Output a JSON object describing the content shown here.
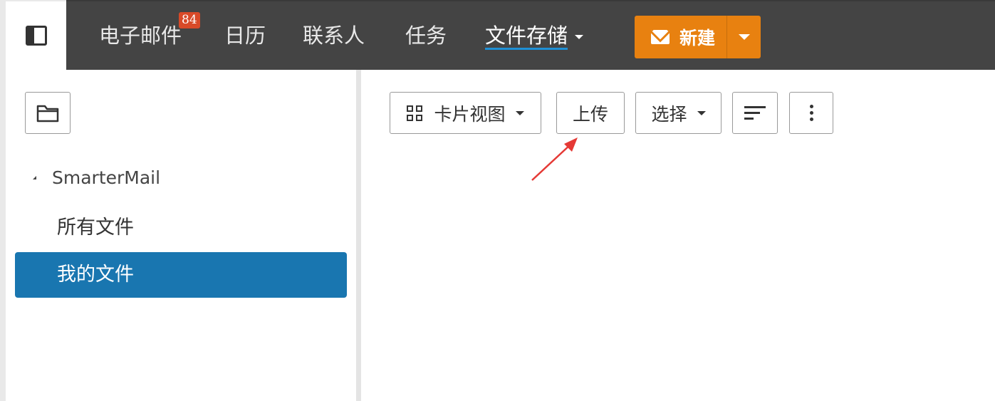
{
  "nav": {
    "items": [
      {
        "label": "电子邮件",
        "badge": "84"
      },
      {
        "label": "日历"
      },
      {
        "label": "联系人"
      },
      {
        "label": "任务"
      },
      {
        "label": "文件存储",
        "active": true
      }
    ],
    "new_button": {
      "label": "新建"
    }
  },
  "sidebar": {
    "root": "SmarterMail",
    "items": [
      {
        "label": "所有文件"
      },
      {
        "label": "我的文件",
        "selected": true
      }
    ]
  },
  "toolbar": {
    "view_label": "卡片视图",
    "upload_label": "上传",
    "select_label": "选择"
  },
  "colors": {
    "nav_bg": "#444444",
    "accent_orange": "#e88110",
    "selected_blue": "#1976b0",
    "badge_red": "#d84a28",
    "annotation_red": "#e53935"
  },
  "icons": [
    "panel-toggle-icon",
    "mail-icon",
    "folder-icon",
    "grid-view-icon",
    "sort-icon",
    "more-vertical-icon",
    "chevron-down-icon"
  ]
}
